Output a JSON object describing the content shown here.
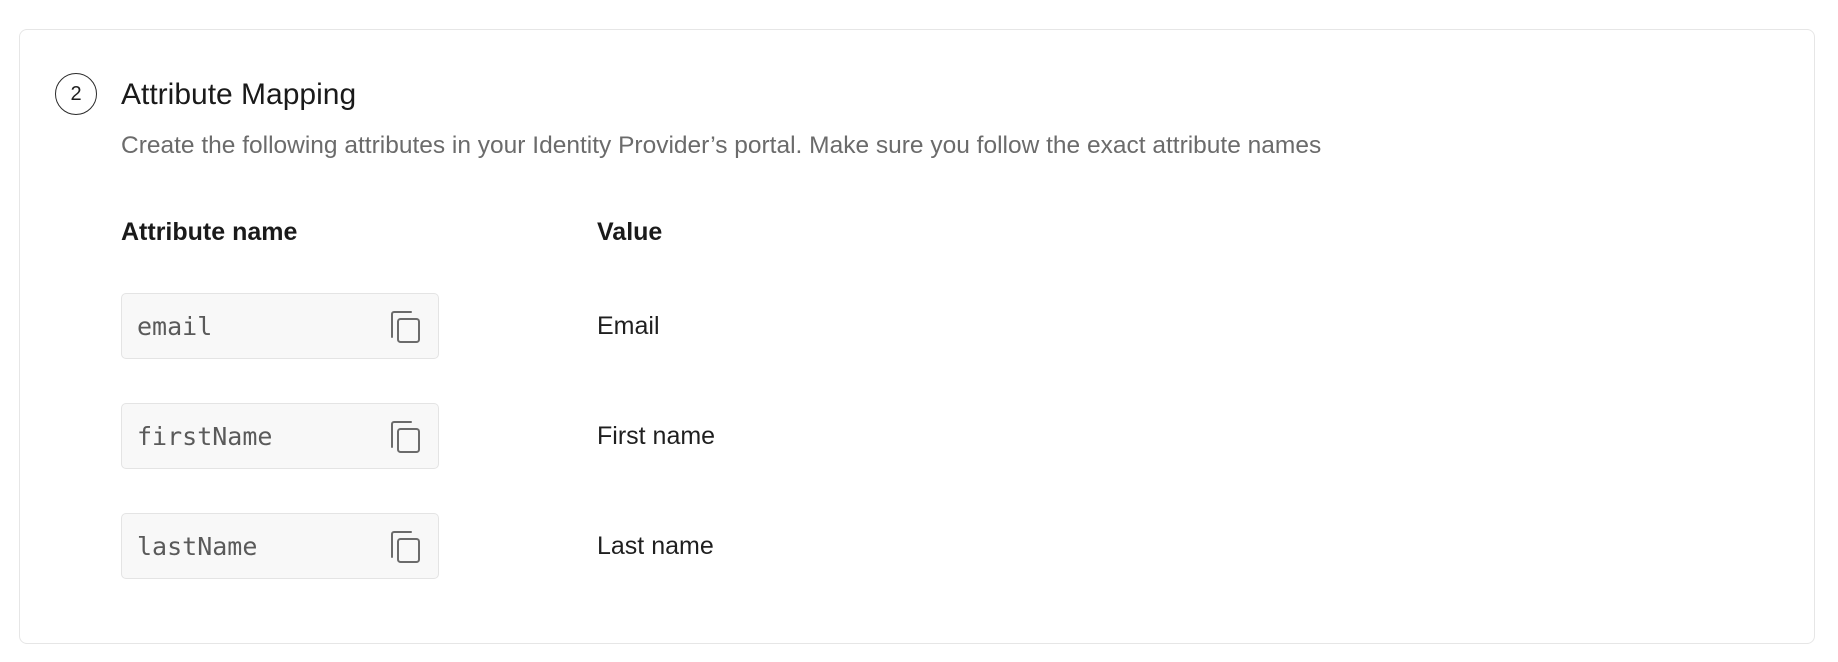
{
  "step": {
    "number": "2",
    "title": "Attribute Mapping",
    "description": "Create the following attributes in your Identity Provider’s portal. Make sure you follow the exact attribute names"
  },
  "table": {
    "headers": {
      "name": "Attribute name",
      "value": "Value"
    },
    "rows": [
      {
        "attribute": "email",
        "value": "Email",
        "icon": "copy-icon"
      },
      {
        "attribute": "firstName",
        "value": "First name",
        "icon": "copy-icon"
      },
      {
        "attribute": "lastName",
        "value": "Last name",
        "icon": "copy-icon"
      }
    ]
  },
  "colors": {
    "border": "#e6e6e6",
    "code_bg": "#f8f8f8",
    "muted_text": "#6b6b6b"
  }
}
